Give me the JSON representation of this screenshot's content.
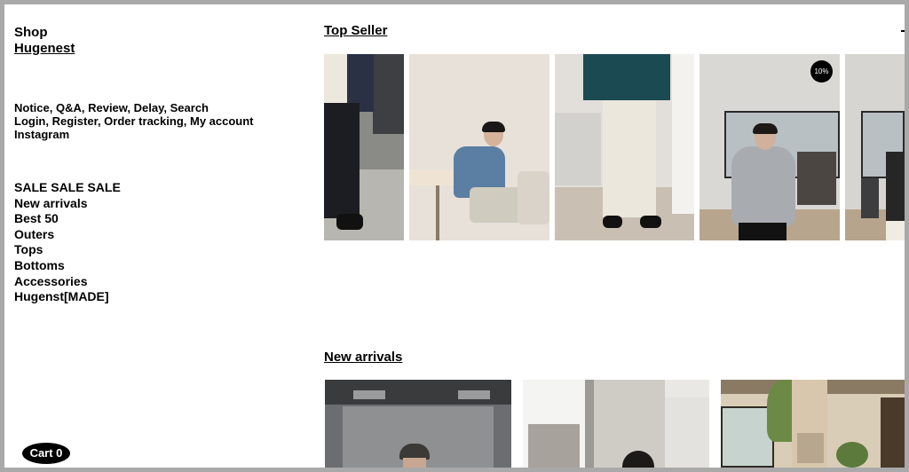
{
  "sidebar": {
    "shop_label": "Shop",
    "brand": "Hugenest",
    "utility_row1": [
      "Notice",
      "Q&A",
      "Review",
      "Delay",
      "Search"
    ],
    "utility_row2": [
      "Login",
      "Register",
      "Order tracking",
      "My account"
    ],
    "utility_row3": [
      "Instagram"
    ],
    "categories": [
      "SALE SALE SALE",
      "New arrivals",
      "Best 50",
      "Outers",
      "Tops",
      "Bottoms",
      "Accessories",
      "Hugenst[MADE]"
    ]
  },
  "cart": {
    "label": "Cart 0"
  },
  "sections": {
    "top_seller": "Top Seller",
    "new_arrivals": "New arrivals"
  },
  "badges": {
    "discount": "10%"
  },
  "colors": {
    "frame": "#a9a9a9",
    "background": "#ffffff",
    "text": "#000000"
  }
}
